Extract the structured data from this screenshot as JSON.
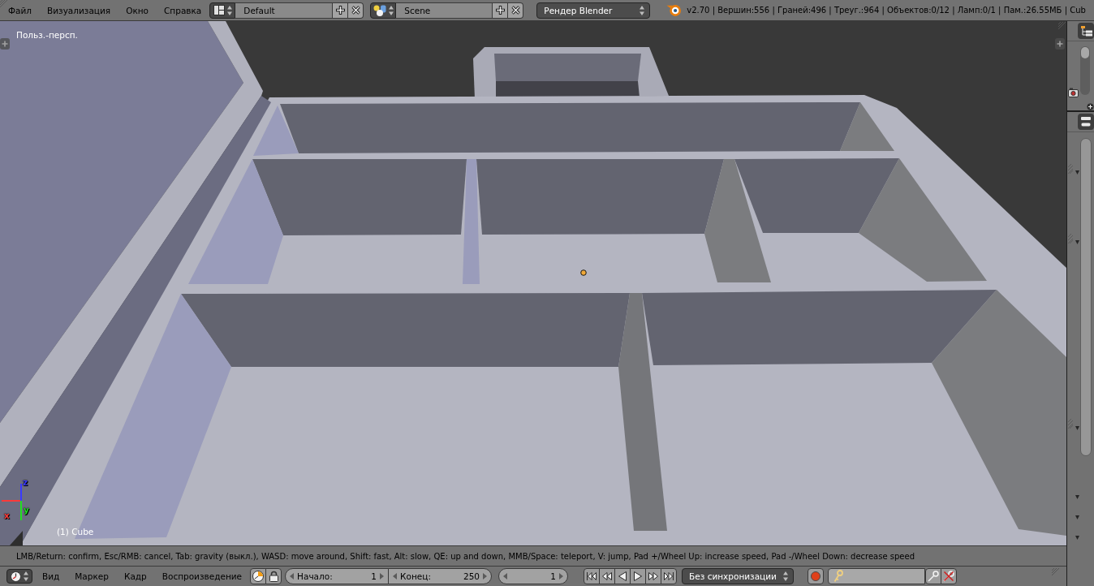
{
  "header": {
    "menus": [
      "Файл",
      "Визуализация",
      "Окно",
      "Справка"
    ],
    "layout": {
      "value": "Default"
    },
    "scene": {
      "value": "Scene"
    },
    "render_engine": "Рендер Blender",
    "stats": "v2.70 | Вершин:556 | Граней:496 | Треуг.:964 | Объектов:0/12 | Ламп:0/1 | Пам.:26.55МБ | Cub"
  },
  "viewport": {
    "view_label": "Польз.-персп.",
    "object_label": "(1) Cube",
    "axes": [
      {
        "label": "x",
        "color": "#ff3a3a"
      },
      {
        "label": "y",
        "color": "#22dd22"
      },
      {
        "label": "z",
        "color": "#3a3aff"
      }
    ]
  },
  "hint_bar": "LMB/Return: confirm, Esc/RMB: cancel, Tab: gravity (выкл.), WASD: move around, Shift: fast, Alt: slow, QE: up and down, MMB/Space: teleport, V: jump, Pad +/Wheel Up: increase speed, Pad -/Wheel Down: decrease speed",
  "timeline": {
    "menus": [
      "Вид",
      "Маркер",
      "Кадр",
      "Воспроизведение"
    ],
    "frame_range": [
      {
        "label": "Начало:",
        "value": "1"
      },
      {
        "label": "Конец:",
        "value": "250"
      }
    ],
    "current_frame": "1",
    "sync": "Без синхронизации"
  }
}
